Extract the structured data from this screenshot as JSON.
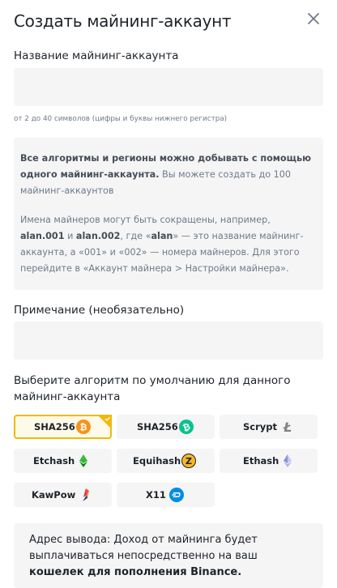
{
  "header": {
    "title": "Создать майнинг-аккаунт",
    "close_icon": "close-icon"
  },
  "account_name": {
    "label": "Название майнинг-аккаунта",
    "value": "",
    "placeholder": "",
    "hint": "от 2 до 40 символов (цифры и буквы нижнего регистра)"
  },
  "info": {
    "p1_bold": "Все алгоритмы и регионы можно добывать с помощью одного майнинг-аккаунта.",
    "p1_rest": " Вы можете создать до 100 майнинг-аккаунтов",
    "p2_a": "Имена майнеров могут быть сокращены, например, ",
    "p2_b1": "alan.001",
    "p2_c": " и ",
    "p2_b2": "alan.002",
    "p2_d": ", где «",
    "p2_b3": "alan",
    "p2_e": "» — это название майнинг-аккаунта, а «001» и «002» — номера майнеров. Для этого перейдите в «Аккаунт майнера > Настройки майнера»."
  },
  "note": {
    "label": "Примечание (необязательно)",
    "value": "",
    "placeholder": ""
  },
  "algorithm": {
    "label": "Выберите алгоритм по умолчанию для данного майнинг-аккаунта",
    "options": [
      {
        "name": "SHA256",
        "icon": "bitcoin-icon",
        "selected": true
      },
      {
        "name": "SHA256",
        "icon": "bitcoin-cash-icon",
        "selected": false
      },
      {
        "name": "Scrypt",
        "icon": "litecoin-icon",
        "selected": false
      },
      {
        "name": "Etchash",
        "icon": "ethereum-classic-icon",
        "selected": false
      },
      {
        "name": "Equihash",
        "icon": "zcash-icon",
        "selected": false
      },
      {
        "name": "Ethash",
        "icon": "ethereum-icon",
        "selected": false
      },
      {
        "name": "KawPow",
        "icon": "ravencoin-icon",
        "selected": false
      },
      {
        "name": "X11",
        "icon": "dash-icon",
        "selected": false
      }
    ]
  },
  "payout": {
    "text": "Адрес вывода: Доход от майнинга будет выплачиваться непосредственно на ваш ",
    "bold": "кошелек для пополнения Binance."
  },
  "colors": {
    "accent": "#f0b90b",
    "bitcoin": "#f7931a",
    "bitcoin_cash": "#0ac18e",
    "field_bg": "#f5f5f5"
  }
}
